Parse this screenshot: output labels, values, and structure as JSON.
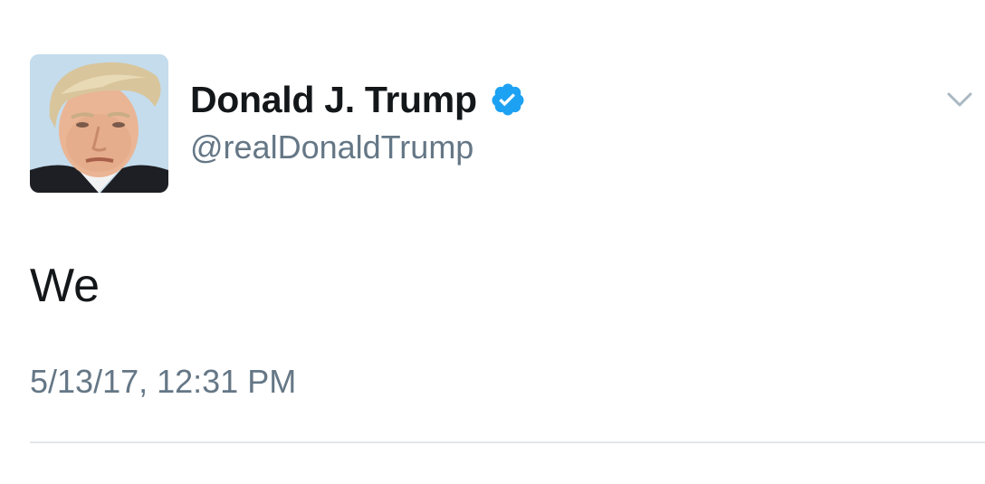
{
  "tweet": {
    "author": {
      "display_name": "Donald J. Trump",
      "handle": "@realDonaldTrump",
      "verified": true,
      "avatar_icon": "avatar-photo"
    },
    "text": "We",
    "timestamp": "5/13/17, 12:31 PM",
    "menu_icon": "chevron-down-icon"
  },
  "colors": {
    "verified_badge": "#1da1f2",
    "primary_text": "#14171a",
    "secondary_text": "#657786",
    "divider": "#e1e8ed",
    "caret": "#aab8c2"
  }
}
